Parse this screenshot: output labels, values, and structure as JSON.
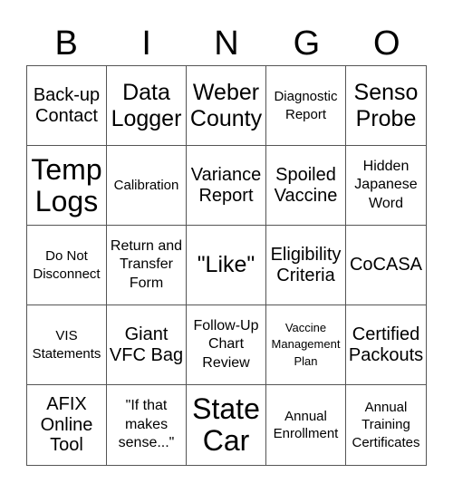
{
  "header": {
    "letters": [
      "B",
      "I",
      "N",
      "G",
      "O"
    ]
  },
  "cells": [
    {
      "text": "Back-up Contact",
      "size": "s-m"
    },
    {
      "text": "Data Logger",
      "size": "s-l"
    },
    {
      "text": "Weber County",
      "size": "s-l"
    },
    {
      "text": "Diagnostic Report",
      "size": "s-s"
    },
    {
      "text": "Senso Probe",
      "size": "s-l"
    },
    {
      "text": "Temp Logs",
      "size": "s-xl"
    },
    {
      "text": "Calibration",
      "size": "s-s"
    },
    {
      "text": "Variance Report",
      "size": "s-m"
    },
    {
      "text": "Spoiled Vaccine",
      "size": "s-m"
    },
    {
      "text": "Hidden Japanese Word",
      "size": "s-sm"
    },
    {
      "text": "Do Not Disconnect",
      "size": "s-s"
    },
    {
      "text": "Return and Transfer Form",
      "size": "s-sm"
    },
    {
      "text": "\"Like\"",
      "size": "s-l"
    },
    {
      "text": "Eligibility Criteria",
      "size": "s-m"
    },
    {
      "text": "CoCASA",
      "size": "s-m"
    },
    {
      "text": "VIS Statements",
      "size": "s-s"
    },
    {
      "text": "Giant VFC Bag",
      "size": "s-m"
    },
    {
      "text": "Follow-Up Chart Review",
      "size": "s-sm"
    },
    {
      "text": "Vaccine Management Plan",
      "size": "s-xs"
    },
    {
      "text": "Certified Packouts",
      "size": "s-m"
    },
    {
      "text": "AFIX Online Tool",
      "size": "s-m"
    },
    {
      "text": "\"If that makes sense...\"",
      "size": "s-sm"
    },
    {
      "text": "State Car",
      "size": "s-xl"
    },
    {
      "text": "Annual Enrollment",
      "size": "s-s"
    },
    {
      "text": "Annual Training Certificates",
      "size": "s-s"
    }
  ]
}
